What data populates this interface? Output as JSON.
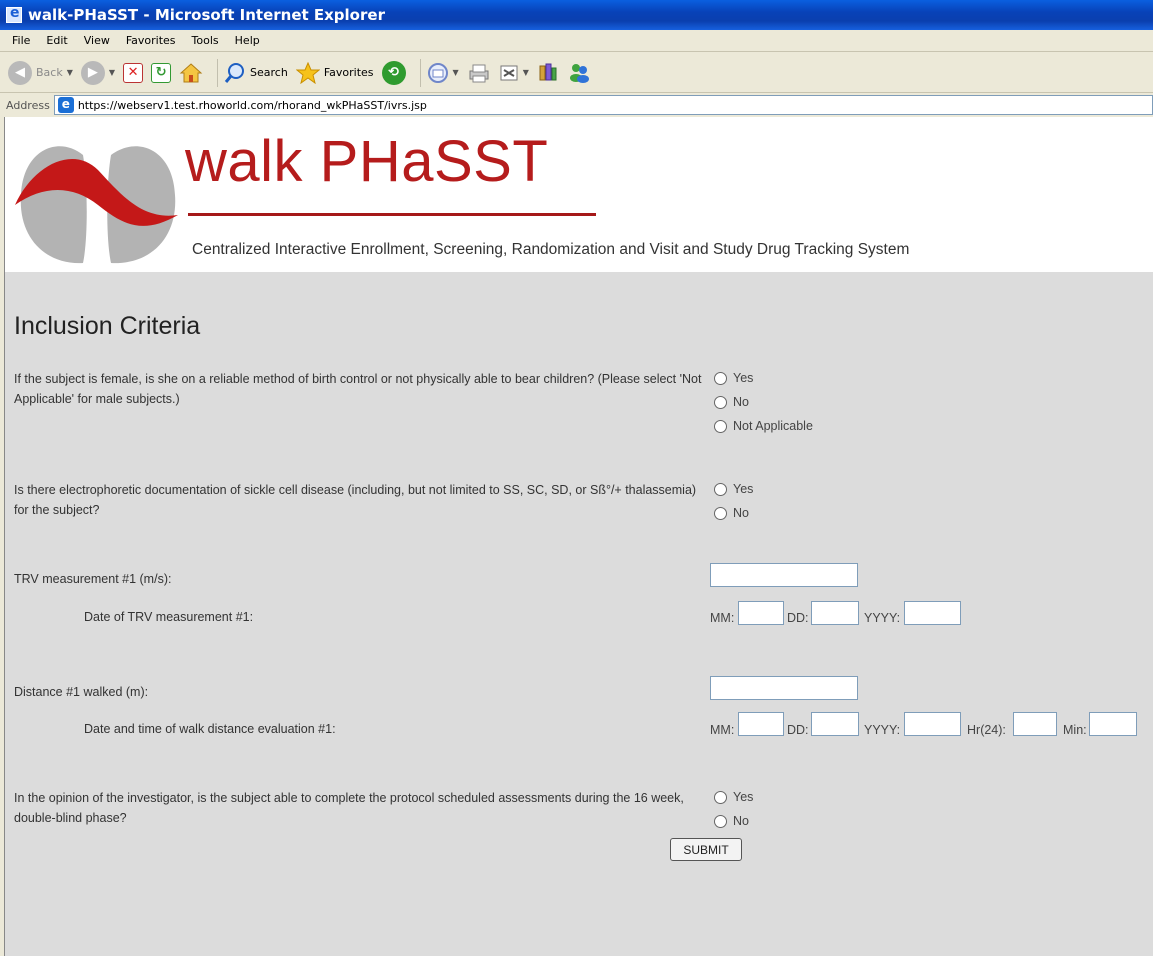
{
  "window": {
    "title": "walk-PHaSST - Microsoft Internet Explorer"
  },
  "menu": [
    "File",
    "Edit",
    "View",
    "Favorites",
    "Tools",
    "Help"
  ],
  "toolbar": {
    "back_label": "Back",
    "search_label": "Search",
    "favorites_label": "Favorites"
  },
  "address": {
    "label": "Address",
    "url": "https://webserv1.test.rhoworld.com/rhorand_wkPHaSST/ivrs.jsp"
  },
  "header": {
    "brand": "walk PHaSST",
    "tagline": "Centralized Interactive Enrollment, Screening, Randomization and Visit and Study Drug Tracking System"
  },
  "form": {
    "heading": "Inclusion Criteria",
    "q1": {
      "text": "If the subject is female, is she on a reliable method of birth control or not physically able to bear children? (Please select 'Not Applicable' for male subjects.)",
      "options": [
        "Yes",
        "No",
        "Not Applicable"
      ]
    },
    "q2": {
      "text": "Is there electrophoretic documentation of sickle cell disease (including, but not limited to SS, SC, SD, or Sß°/+ thalassemia) for the subject?",
      "options": [
        "Yes",
        "No"
      ]
    },
    "trv": {
      "label": "TRV measurement #1 (m/s):",
      "date_label": "Date of TRV measurement #1:",
      "mm": "MM:",
      "dd": "DD:",
      "yyyy": "YYYY:"
    },
    "distance": {
      "label": "Distance #1 walked (m):",
      "date_label": "Date and time of walk distance evaluation #1:",
      "mm": "MM:",
      "dd": "DD:",
      "yyyy": "YYYY:",
      "hr": "Hr(24):",
      "min": "Min:"
    },
    "q3": {
      "text": "In the opinion of the investigator, is the subject able to complete the protocol scheduled assessments during the 16 week, double-blind phase?",
      "options": [
        "Yes",
        "No"
      ]
    },
    "submit_label": "SUBMIT"
  }
}
